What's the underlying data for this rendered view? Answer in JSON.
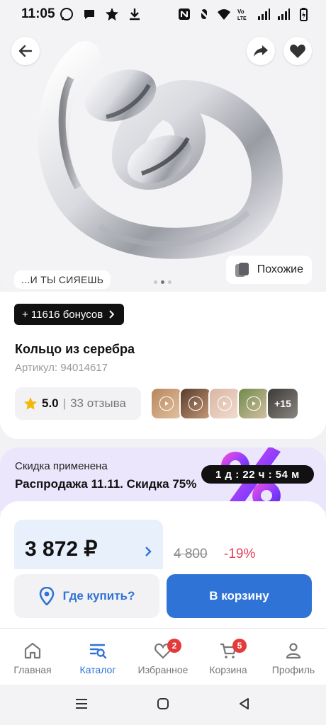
{
  "status_bar": {
    "time": "11:05"
  },
  "hero": {
    "brand_tag": "...И ТЫ СИЯЕШЬ",
    "similar_label": "Похожие"
  },
  "product": {
    "bonus_label": "+ 11616 бонусов",
    "title": "Кольцо из серебра",
    "sku": "Артикул: 94014617",
    "rating": "5.0",
    "reviews": "33 отзыва",
    "more_media": "+15"
  },
  "sale": {
    "subtitle": "Скидка применена",
    "title": "Распродажа 11.11. Скидка 75%",
    "timer": "1 д : 22 ч : 54 м"
  },
  "price": {
    "current": "3 872 ₽",
    "old": "4 800",
    "discount": "-19%"
  },
  "actions": {
    "where_label": "Где купить?",
    "cart_label": "В корзину"
  },
  "nav": {
    "home": "Главная",
    "catalog": "Каталог",
    "favorites": "Избранное",
    "favorites_count": "2",
    "cart": "Корзина",
    "cart_count": "5",
    "profile": "Профиль"
  },
  "colors": {
    "accent": "#2f73d6",
    "sale_bg": "#ebe6fb",
    "discount": "#e0405a",
    "badge": "#e43a3a"
  },
  "icons": [
    "back-icon",
    "share-icon",
    "heart-icon",
    "similar-icon",
    "star-icon",
    "play-icon",
    "location-icon",
    "chevron-right-icon",
    "home-icon",
    "catalog-icon",
    "favorites-icon",
    "cart-icon",
    "profile-icon"
  ]
}
